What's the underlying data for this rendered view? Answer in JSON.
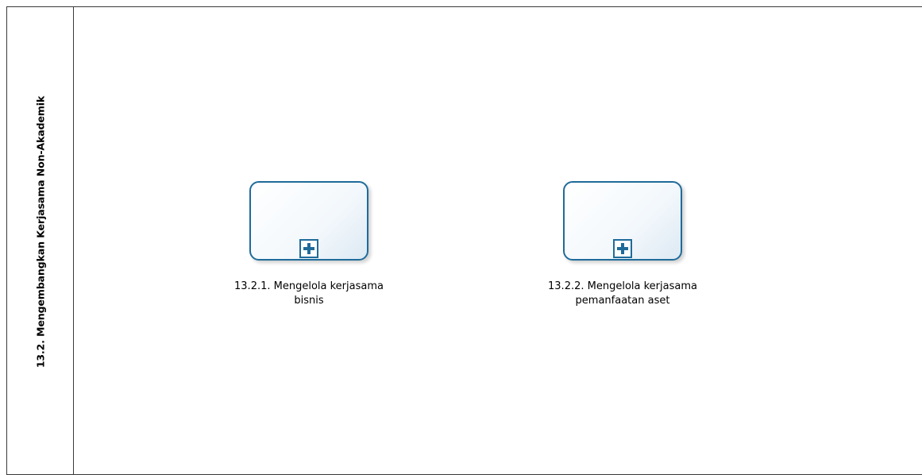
{
  "diagram": {
    "lane": {
      "title": "13.2. Mengembangkan Kerjasama Non-Akademik"
    },
    "tasks": [
      {
        "line1": "13.2.1. Mengelola kerjasama",
        "line2": "bisnis",
        "marker": "plus-icon"
      },
      {
        "line1": "13.2.2. Mengelola kerjasama",
        "line2": "pemanfaatan aset",
        "marker": "plus-icon"
      }
    ],
    "colors": {
      "task_border": "#1f6b9a",
      "lane_border": "#3a3a3a"
    }
  }
}
